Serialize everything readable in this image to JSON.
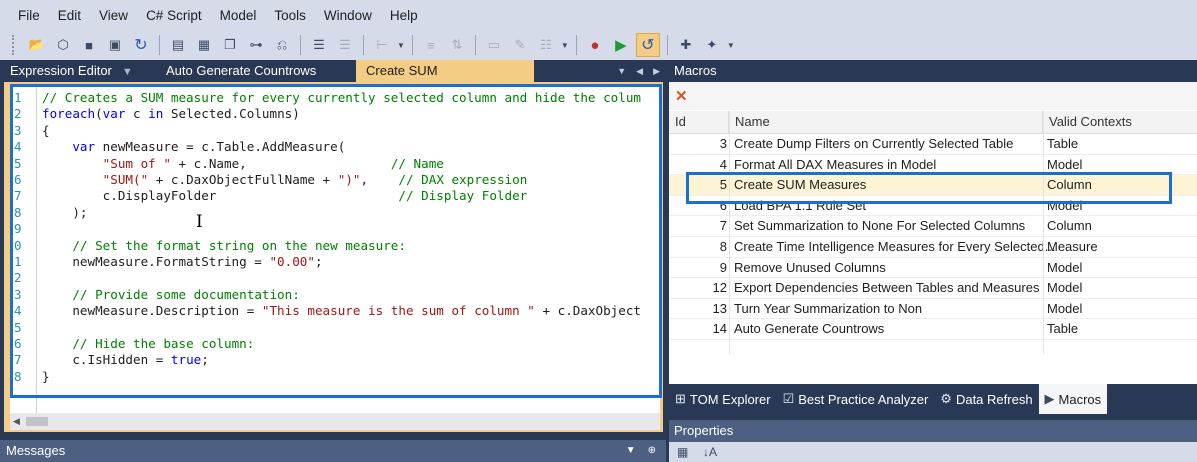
{
  "menu": [
    "File",
    "Edit",
    "View",
    "C# Script",
    "Model",
    "Tools",
    "Window",
    "Help"
  ],
  "toolbar": {
    "icons": [
      "open-icon",
      "cube-icon",
      "save-icon",
      "save-all-icon",
      "refresh-icon",
      "script-icon",
      "table-icon",
      "copy-icon",
      "hierarchy-icon",
      "undo-icon",
      "align-left-icon",
      "align-right-icon",
      "tree-icon",
      "stack-icon",
      "move-icon",
      "textbox-icon",
      "comment-icon",
      "list-icon",
      "stop-icon",
      "run-icon",
      "redo-active-icon",
      "add-macro-icon",
      "edit-macro-icon"
    ]
  },
  "tabs": [
    {
      "label": "Expression Editor",
      "active": false
    },
    {
      "label": "Auto Generate Countrows",
      "active": false
    },
    {
      "label": "Create SUM Measures",
      "active": true
    }
  ],
  "editor": {
    "line_numbers": [
      "1",
      "2",
      "3",
      "4",
      "5",
      "6",
      "7",
      "8",
      "9",
      "0",
      "1",
      "2",
      "3",
      "4",
      "5",
      "6",
      "7",
      "8"
    ],
    "lines": [
      [
        {
          "c": "cm",
          "t": "// Creates a SUM measure for every currently selected column and hide the colum"
        }
      ],
      [
        {
          "c": "kw",
          "t": "foreach"
        },
        {
          "c": "tx",
          "t": "("
        },
        {
          "c": "kw",
          "t": "var"
        },
        {
          "c": "tx",
          "t": " c "
        },
        {
          "c": "kw",
          "t": "in"
        },
        {
          "c": "tx",
          "t": " Selected.Columns)"
        }
      ],
      [
        {
          "c": "tx",
          "t": "{"
        }
      ],
      [
        {
          "c": "tx",
          "t": "    "
        },
        {
          "c": "kw",
          "t": "var"
        },
        {
          "c": "tx",
          "t": " newMeasure = c.Table.AddMeasure("
        }
      ],
      [
        {
          "c": "tx",
          "t": "        "
        },
        {
          "c": "st",
          "t": "\"Sum of \""
        },
        {
          "c": "tx",
          "t": " + c.Name,                   "
        },
        {
          "c": "cm",
          "t": "// Name"
        }
      ],
      [
        {
          "c": "tx",
          "t": "        "
        },
        {
          "c": "st",
          "t": "\"SUM(\""
        },
        {
          "c": "tx",
          "t": " + c.DaxObjectFullName + "
        },
        {
          "c": "st",
          "t": "\")\""
        },
        {
          "c": "tx",
          "t": ",    "
        },
        {
          "c": "cm",
          "t": "// DAX expression"
        }
      ],
      [
        {
          "c": "tx",
          "t": "        c.DisplayFolder                        "
        },
        {
          "c": "cm",
          "t": "// Display Folder"
        }
      ],
      [
        {
          "c": "tx",
          "t": "    );"
        }
      ],
      [
        {
          "c": "tx",
          "t": ""
        }
      ],
      [
        {
          "c": "tx",
          "t": "    "
        },
        {
          "c": "cm",
          "t": "// Set the format string on the new measure:"
        }
      ],
      [
        {
          "c": "tx",
          "t": "    newMeasure.FormatString = "
        },
        {
          "c": "st",
          "t": "\"0.00\""
        },
        {
          "c": "tx",
          "t": ";"
        }
      ],
      [
        {
          "c": "tx",
          "t": ""
        }
      ],
      [
        {
          "c": "tx",
          "t": "    "
        },
        {
          "c": "cm",
          "t": "// Provide some documentation:"
        }
      ],
      [
        {
          "c": "tx",
          "t": "    newMeasure.Description = "
        },
        {
          "c": "st",
          "t": "\"This measure is the sum of column \""
        },
        {
          "c": "tx",
          "t": " + c.DaxObject"
        }
      ],
      [
        {
          "c": "tx",
          "t": ""
        }
      ],
      [
        {
          "c": "tx",
          "t": "    "
        },
        {
          "c": "cm",
          "t": "// Hide the base column:"
        }
      ],
      [
        {
          "c": "tx",
          "t": "    c.IsHidden = "
        },
        {
          "c": "kw",
          "t": "true"
        },
        {
          "c": "tx",
          "t": ";"
        }
      ],
      [
        {
          "c": "tx",
          "t": "}"
        }
      ]
    ]
  },
  "messages_title": "Messages",
  "macros": {
    "title": "Macros",
    "columns": [
      "Id",
      "Name",
      "Valid Contexts"
    ],
    "rows": [
      {
        "id": "3",
        "name": "Create Dump Filters on Currently Selected Table",
        "context": "Table"
      },
      {
        "id": "4",
        "name": "Format All DAX Measures in Model",
        "context": "Model"
      },
      {
        "id": "5",
        "name": "Create SUM Measures",
        "context": "Column",
        "selected": true
      },
      {
        "id": "6",
        "name": "Load BPA 1.1 Rule Set",
        "context": "Model"
      },
      {
        "id": "7",
        "name": "Set Summarization to None For Selected Columns",
        "context": "Column"
      },
      {
        "id": "8",
        "name": "Create Time Intelligence Measures for Every Selected...",
        "context": "Measure"
      },
      {
        "id": "9",
        "name": "Remove Unused Columns",
        "context": "Model"
      },
      {
        "id": "12",
        "name": "Export Dependencies Between Tables and Measures",
        "context": "Model"
      },
      {
        "id": "13",
        "name": "Turn Year Summarization to Non",
        "context": "Model"
      },
      {
        "id": "14",
        "name": "Auto Generate Countrows",
        "context": "Table"
      }
    ]
  },
  "bottom_tabs": [
    {
      "label": "TOM Explorer",
      "icon": "tree-icon"
    },
    {
      "label": "Best Practice Analyzer",
      "icon": "checklist-icon"
    },
    {
      "label": "Data Refresh",
      "icon": "gears-icon"
    },
    {
      "label": "Macros",
      "icon": "macro-icon",
      "active": true
    }
  ],
  "properties_title": "Properties",
  "colors": {
    "accent_tab": "#f5cc84",
    "highlight_border": "#1a6fd1",
    "chrome": "#293955"
  }
}
